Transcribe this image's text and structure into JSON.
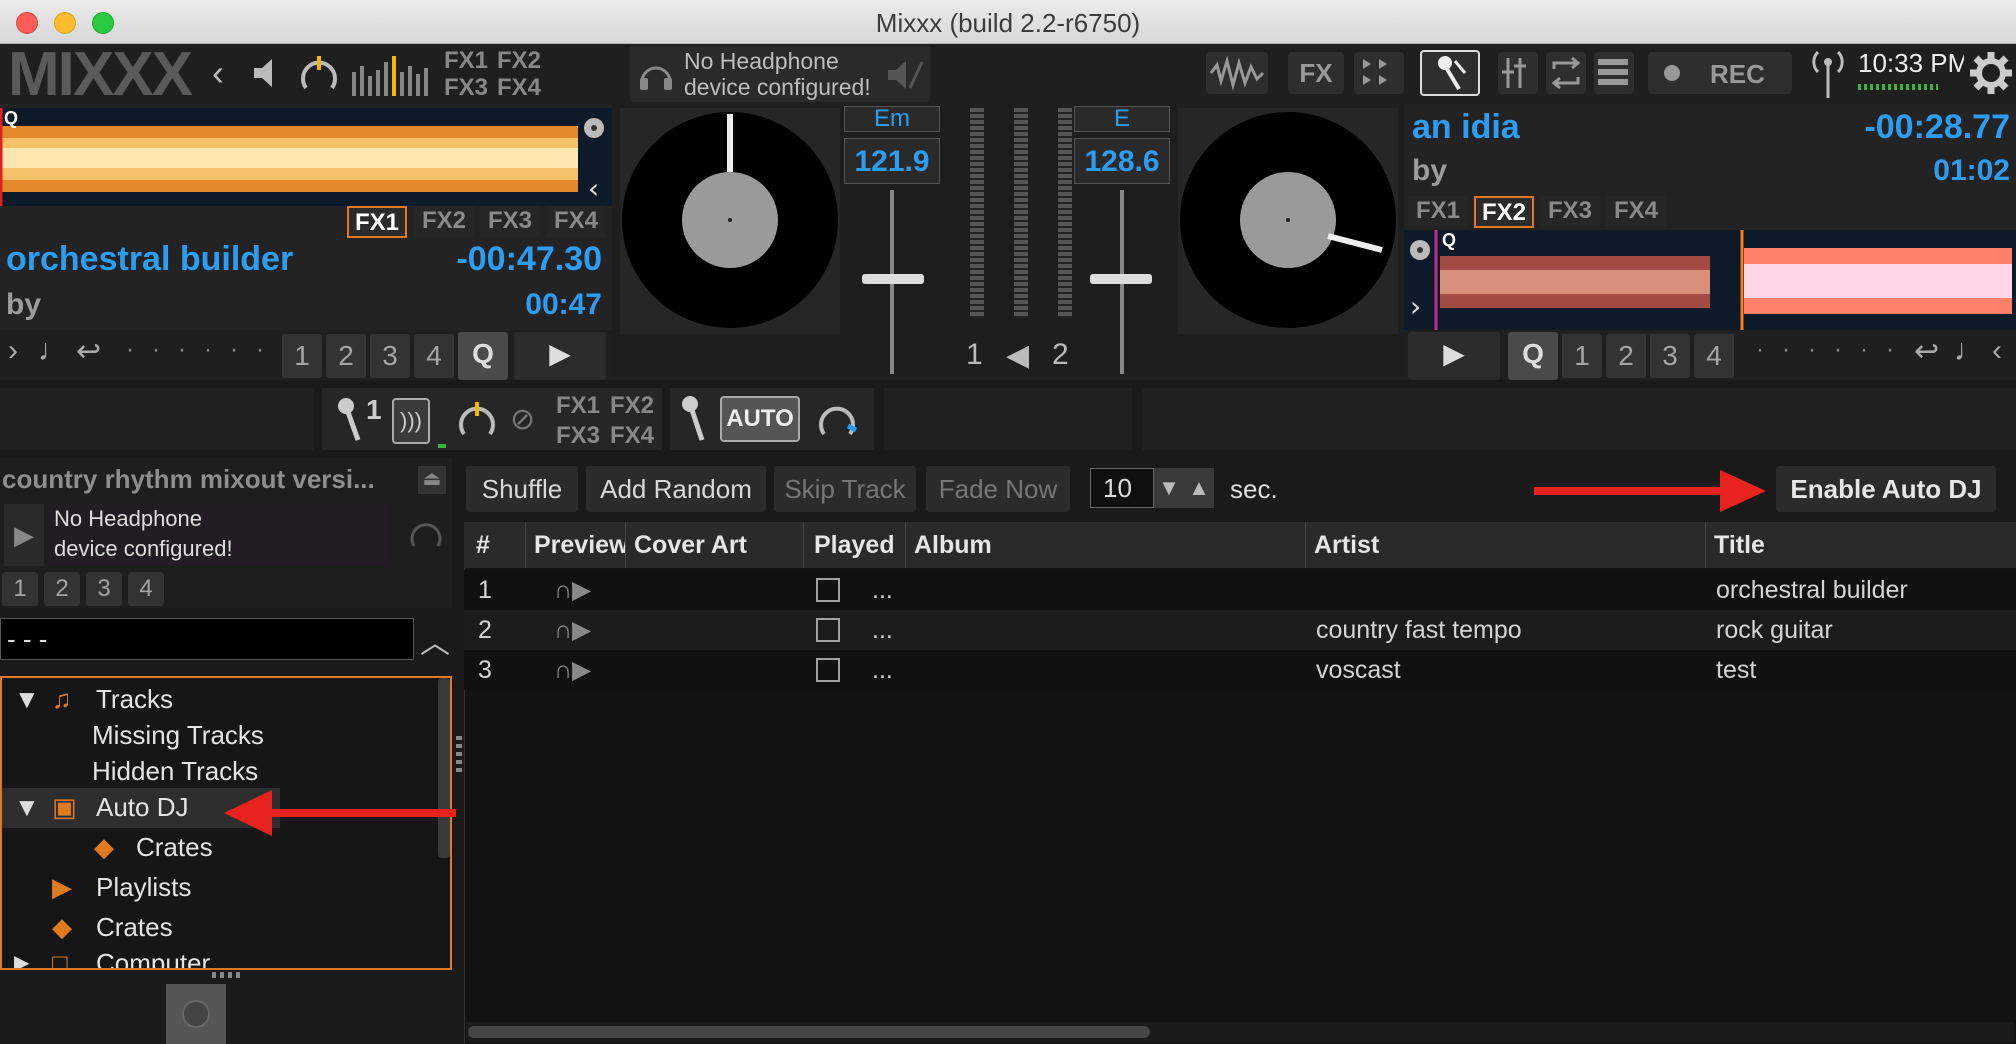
{
  "window": {
    "title": "Mixxx (build 2.2-r6750)"
  },
  "top": {
    "logo": "MIXXX",
    "fx_labels": [
      "FX1",
      "FX2",
      "FX3",
      "FX4"
    ],
    "headphone_msg_line1": "No Headphone",
    "headphone_msg_line2": "device configured!",
    "fx_button": "FX",
    "rec_label": "REC",
    "clock": "10:33 PM"
  },
  "deck1": {
    "title": "orchestral builder",
    "artist": "by",
    "time_remaining": "-00:47.30",
    "time_elapsed": "00:47",
    "fx": [
      "FX1",
      "FX2",
      "FX3",
      "FX4"
    ],
    "fx_active": "FX1",
    "hotcues": [
      "1",
      "2",
      "3",
      "4"
    ],
    "cue_label": "Q",
    "key": "Em",
    "bpm": "121.9",
    "waveform_marker": "Q"
  },
  "deck2": {
    "title": "an idia",
    "artist": "by",
    "time_remaining": "-00:28.77",
    "time_elapsed": "01:02",
    "fx": [
      "FX1",
      "FX2",
      "FX3",
      "FX4"
    ],
    "fx_active": "FX2",
    "hotcues": [
      "1",
      "2",
      "3",
      "4"
    ],
    "cue_label": "Q",
    "key": "E",
    "bpm": "128.6",
    "waveform_marker": "Q"
  },
  "mixer": {
    "ch1": "1",
    "ch2": "2"
  },
  "mic": {
    "num": "1",
    "fx": [
      "FX1",
      "FX2",
      "FX3",
      "FX4"
    ],
    "auto_label": "AUTO"
  },
  "preview": {
    "title": "country rhythm mixout versi...",
    "msg_line1": "No Headphone",
    "msg_line2": "device configured!",
    "hotcues": [
      "1",
      "2",
      "3",
      "4"
    ]
  },
  "search": {
    "value": "- - -"
  },
  "sidebar": {
    "items": [
      {
        "label": "Tracks"
      },
      {
        "label": "Missing Tracks"
      },
      {
        "label": "Hidden Tracks"
      },
      {
        "label": "Auto DJ"
      },
      {
        "label": "Crates"
      },
      {
        "label": "Playlists"
      },
      {
        "label": "Crates"
      },
      {
        "label": "Computer"
      }
    ]
  },
  "autodj": {
    "shuffle": "Shuffle",
    "add_random": "Add Random",
    "skip_track": "Skip Track",
    "fade_now": "Fade Now",
    "transition_seconds": "10",
    "sec_label": "sec.",
    "enable": "Enable Auto DJ"
  },
  "table": {
    "columns": [
      "#",
      "Preview",
      "Cover Art",
      "Played",
      "Album",
      "Artist",
      "Title"
    ],
    "rows": [
      {
        "num": "1",
        "album": "...",
        "artist": "",
        "title": "orchestral builder"
      },
      {
        "num": "2",
        "album": "...",
        "artist": "country fast tempo",
        "title": "rock guitar"
      },
      {
        "num": "3",
        "album": "...",
        "artist": "voscast",
        "title": "test"
      }
    ]
  },
  "colors": {
    "accent": "#2b9df2",
    "orange": "#e07a1e",
    "annotation_red": "#e8231f"
  }
}
